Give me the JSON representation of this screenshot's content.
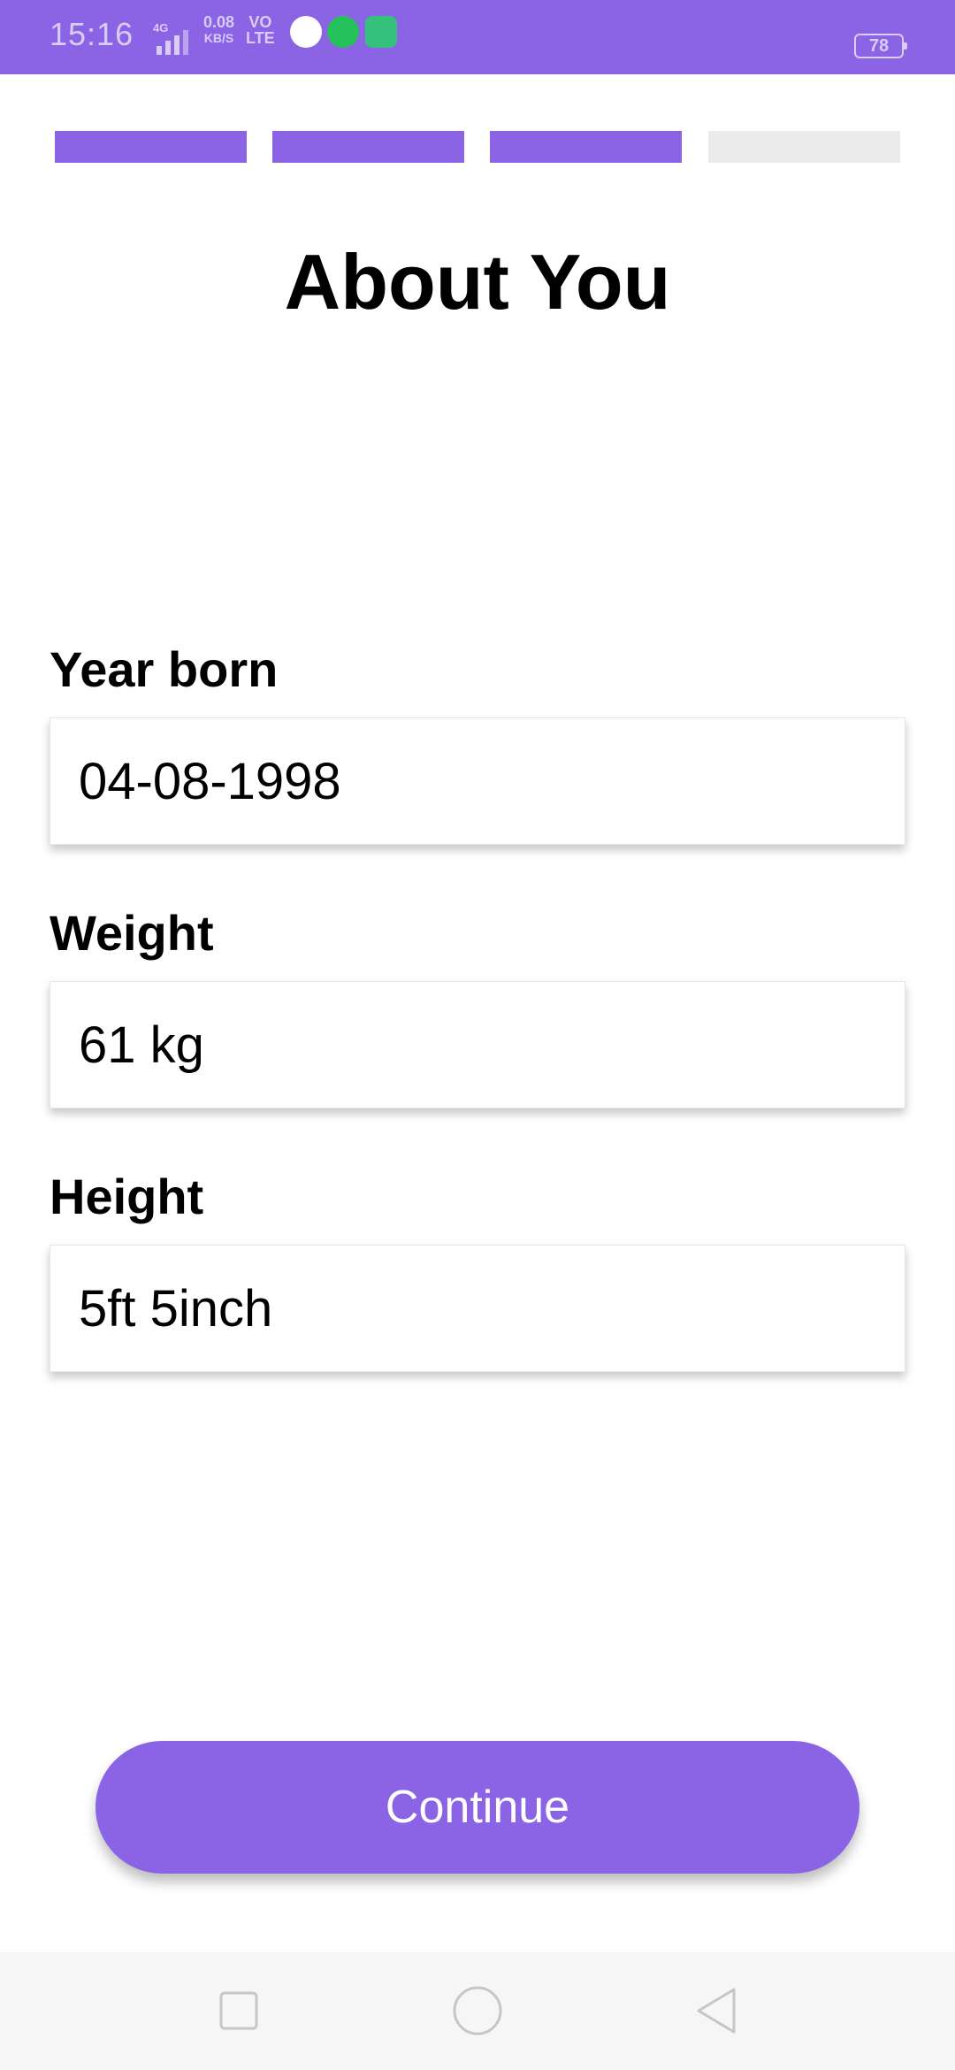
{
  "status_bar": {
    "time": "15:16",
    "network_speed_top": "0.08",
    "network_speed_bottom": "KB/S",
    "volte_top": "VO",
    "volte_bottom": "LTE",
    "battery": "78",
    "icons": [
      "signal-icon",
      "location-app-icon",
      "whatsapp-icon",
      "chat-app-icon",
      "battery-icon"
    ]
  },
  "progress": {
    "total_steps": 4,
    "completed_steps": 3,
    "active_color": "#8b64e6",
    "inactive_color": "#ebebeb"
  },
  "page": {
    "title": "About You"
  },
  "form": {
    "year_born": {
      "label": "Year born",
      "value": "04-08-1998"
    },
    "weight": {
      "label": "Weight",
      "value": "61 kg"
    },
    "height": {
      "label": "Height",
      "value": "5ft 5inch"
    }
  },
  "actions": {
    "continue_label": "Continue"
  },
  "nav_bar": {
    "icons": [
      "recent-apps-icon",
      "home-icon",
      "back-icon"
    ]
  }
}
